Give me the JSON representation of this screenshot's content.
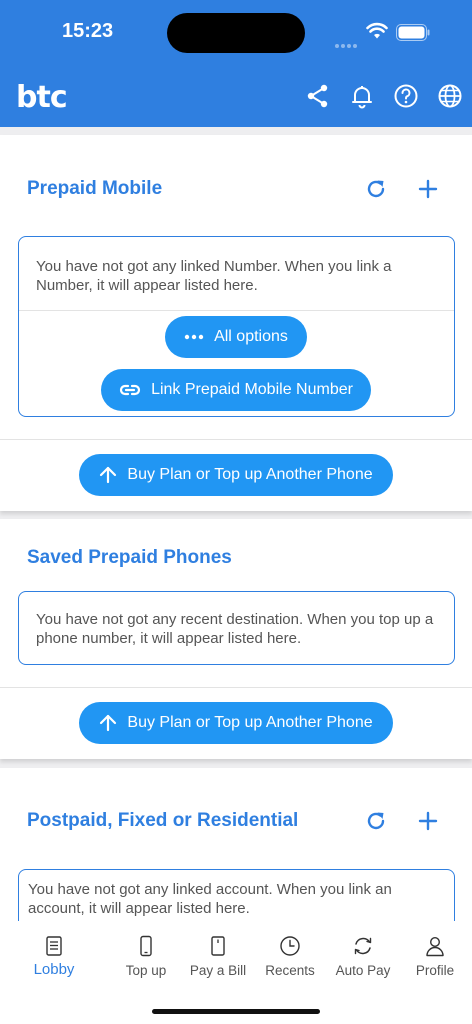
{
  "status": {
    "time": "15:23"
  },
  "app": {
    "logo": "btc"
  },
  "prepaid": {
    "title": "Prepaid Mobile",
    "empty_text": "You have not got any linked Number. When you link a Number, it will appear listed here.",
    "all_options_label": "All options",
    "link_label": "Link Prepaid Mobile Number",
    "buy_label": "Buy Plan or Top up Another Phone"
  },
  "saved": {
    "title": "Saved Prepaid Phones",
    "empty_text": "You have not got any recent destination. When you top up a phone number, it will appear listed here.",
    "buy_label": "Buy Plan or Top up Another Phone"
  },
  "postpaid": {
    "title": "Postpaid, Fixed or Residential",
    "empty_text": "You have not got any linked account. When you link an account, it will appear listed here."
  },
  "tabs": [
    {
      "label": "Lobby",
      "icon": "document-icon",
      "active": true
    },
    {
      "label": "Top up",
      "icon": "phone-icon",
      "active": false
    },
    {
      "label": "Pay a Bill",
      "icon": "bill-icon",
      "active": false
    },
    {
      "label": "Recents",
      "icon": "clock-icon",
      "active": false
    },
    {
      "label": "Auto Pay",
      "icon": "sync-icon",
      "active": false
    },
    {
      "label": "Profile",
      "icon": "person-icon",
      "active": false
    }
  ],
  "colors": {
    "brand": "#2f7fe0",
    "button": "#2196f3"
  }
}
